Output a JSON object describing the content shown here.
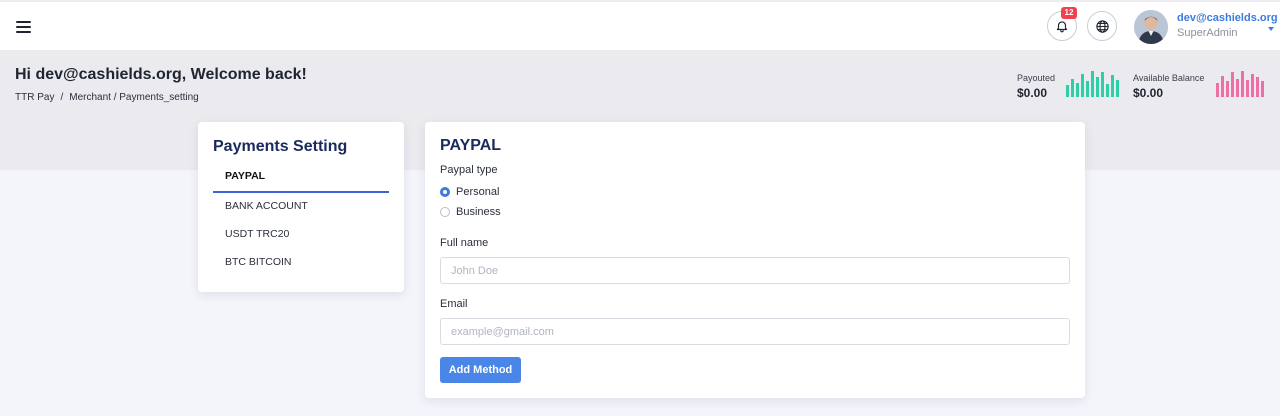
{
  "topbar": {
    "notifications_count": "12",
    "user_email": "dev@cashields.org",
    "user_role": "SuperAdmin"
  },
  "header": {
    "greeting": "Hi dev@cashields.org, Welcome back!",
    "breadcrumb": [
      "TTR Pay",
      "Merchant / Payments_setting"
    ]
  },
  "stats": [
    {
      "label": "Payouted",
      "value": "$0.00",
      "color": "#2ecfa8",
      "bars": [
        0.45,
        0.7,
        0.55,
        0.9,
        0.6,
        1.0,
        0.75,
        0.95,
        0.5,
        0.85,
        0.65
      ]
    },
    {
      "label": "Available Balance",
      "value": "$0.00",
      "color": "#ee6ea6",
      "bars": [
        0.55,
        0.8,
        0.6,
        0.95,
        0.7,
        1.0,
        0.65,
        0.9,
        0.75,
        0.6
      ]
    }
  ],
  "sidebar": {
    "title": "Payments Setting",
    "items": [
      {
        "label": "PAYPAL",
        "active": true
      },
      {
        "label": "BANK ACCOUNT",
        "active": false
      },
      {
        "label": "USDT TRC20",
        "active": false
      },
      {
        "label": "BTC BITCOIN",
        "active": false
      }
    ]
  },
  "form": {
    "title": "PAYPAL",
    "type_label": "Paypal type",
    "type_options": [
      {
        "label": "Personal",
        "checked": true
      },
      {
        "label": "Business",
        "checked": false
      }
    ],
    "fullname_label": "Full name",
    "fullname_placeholder": "John Doe",
    "email_label": "Email",
    "email_placeholder": "example@gmail.com",
    "submit_label": "Add Method"
  },
  "colors": {
    "accent": "#4a86e8",
    "badge": "#f0414f",
    "title": "#1a2a5a"
  },
  "icons": {
    "menu": "hamburger-menu-icon",
    "bell": "bell-icon",
    "globe": "globe-icon",
    "caret": "caret-down-icon"
  }
}
